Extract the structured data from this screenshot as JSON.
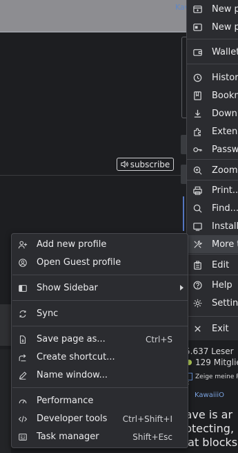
{
  "background": {
    "tab_label": "Kav",
    "subscribe_label": "subscribe",
    "stats": {
      "readers": "5.637 Leser",
      "members": "129 Mitglied",
      "show_mine": "Zeige meine P",
      "colon_label": "s:",
      "user": "KawaiiiO",
      "paragraph": [
        "rave is ar",
        "rotecting,",
        "nat blocks"
      ]
    }
  },
  "main_menu": {
    "items": [
      {
        "label": "New p",
        "icon": "new-tab-icon"
      },
      {
        "label": "New p",
        "icon": "new-private-window-icon"
      },
      {
        "label": "Wallet",
        "icon": "wallet-icon"
      },
      {
        "label": "History",
        "icon": "history-icon"
      },
      {
        "label": "Bookm",
        "icon": "bookmarks-icon"
      },
      {
        "label": "Downl",
        "icon": "downloads-icon"
      },
      {
        "label": "Extens",
        "icon": "extensions-icon"
      },
      {
        "label": "Passwo",
        "icon": "password-key-icon"
      },
      {
        "label": "Zoom",
        "icon": "zoom-icon"
      },
      {
        "label": "Print...",
        "icon": "print-icon"
      },
      {
        "label": "Find...",
        "icon": "find-icon"
      },
      {
        "label": "Install",
        "icon": "install-icon"
      },
      {
        "label": "More t",
        "icon": "more-tools-icon"
      },
      {
        "label": "Edit",
        "icon": "edit-icon"
      },
      {
        "label": "Help",
        "icon": "help-icon"
      },
      {
        "label": "Setting",
        "icon": "settings-icon"
      },
      {
        "label": "Exit",
        "icon": "exit-icon"
      }
    ]
  },
  "context_menu": {
    "add_new_profile": "Add new profile",
    "open_guest_profile": "Open Guest profile",
    "show_sidebar": "Show Sidebar",
    "sync": "Sync",
    "save_page_as": "Save page as...",
    "save_page_as_shortcut": "Ctrl+S",
    "create_shortcut": "Create shortcut...",
    "name_window": "Name window...",
    "performance": "Performance",
    "developer_tools": "Developer tools",
    "developer_tools_shortcut": "Ctrl+Shift+I",
    "task_manager": "Task manager",
    "task_manager_shortcut": "Shift+Esc"
  },
  "colors": {
    "menu_bg": "#2b2c30",
    "menu_active": "#3f4146",
    "text": "#ececee",
    "page_bg": "#1d1e21",
    "link": "#7aa2df"
  }
}
